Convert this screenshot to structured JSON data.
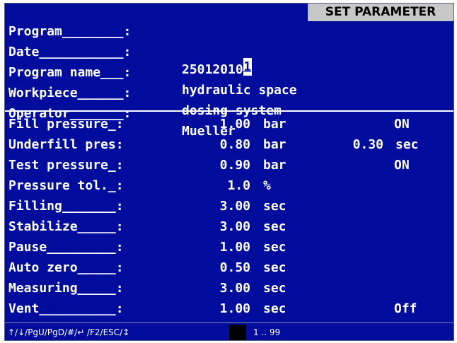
{
  "header": {
    "title_badge": "SET PARAMETER",
    "fields": [
      {
        "label": "Program________:",
        "value": "1"
      },
      {
        "label": "Date___________:",
        "value": "25012010"
      },
      {
        "label": "Program name___:",
        "value": "hydraulic space"
      },
      {
        "label": "Workpiece______:",
        "value": "dosing system"
      },
      {
        "label": "Operator_______:",
        "value": "Mueller"
      }
    ]
  },
  "parameters": [
    {
      "label": "Fill pressure_:",
      "value": "1.00",
      "unit": "bar",
      "extra_value": "",
      "extra_unit": "",
      "status": "ON"
    },
    {
      "label": "Underfill pres:",
      "value": "0.80",
      "unit": "bar",
      "extra_value": "0.30",
      "extra_unit": "sec",
      "status": ""
    },
    {
      "label": "Test pressure_:",
      "value": "0.90",
      "unit": "bar",
      "extra_value": "",
      "extra_unit": "",
      "status": "ON"
    },
    {
      "label": "Pressure tol._:",
      "value": "1.0",
      "unit": "%",
      "extra_value": "",
      "extra_unit": "",
      "status": ""
    },
    {
      "label": "Filling_______:",
      "value": "3.00",
      "unit": "sec",
      "extra_value": "",
      "extra_unit": "",
      "status": ""
    },
    {
      "label": "Stabilize_____:",
      "value": "3.00",
      "unit": "sec",
      "extra_value": "",
      "extra_unit": "",
      "status": ""
    },
    {
      "label": "Pause_________:",
      "value": "1.00",
      "unit": "sec",
      "extra_value": "",
      "extra_unit": "",
      "status": ""
    },
    {
      "label": "Auto zero_____:",
      "value": "0.50",
      "unit": "sec",
      "extra_value": "",
      "extra_unit": "",
      "status": ""
    },
    {
      "label": "Measuring_____:",
      "value": "3.00",
      "unit": "sec",
      "extra_value": "",
      "extra_unit": "",
      "status": ""
    },
    {
      "label": "Vent__________:",
      "value": "1.00",
      "unit": "sec",
      "extra_value": "",
      "extra_unit": "",
      "status": "Off"
    }
  ],
  "status_bar": {
    "keys": "↑/↓/PgU/PgD/#/↵ /F2/ESC/↕",
    "range": "1 .. 99"
  },
  "colors": {
    "background": "#000c9c",
    "text": "#ffffff",
    "title_badge_bg": "#c8c8c8"
  }
}
